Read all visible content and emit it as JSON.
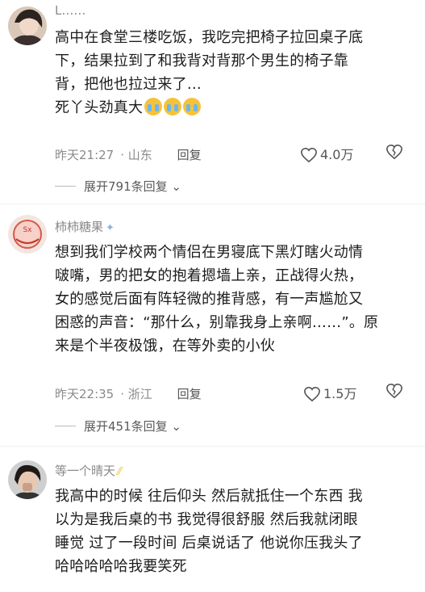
{
  "comments": [
    {
      "username": "L……",
      "lines": [
        "高中在食堂三楼吃饭，我吃完把椅子拉回桌子底",
        "下，结果拉到了和我背对背那个男生的椅子靠",
        "背，把他也拉过来了…",
        "死丫头劲真大"
      ],
      "emoji_icon": "crying-face-emoji",
      "emoji_count": 3,
      "time": "昨天21:27",
      "location": "山东",
      "reply_label": "回复",
      "likes": "4.0万",
      "expand": "展开791条回复"
    },
    {
      "username": "柿柿糖果",
      "lines": [
        "想到我们学校两个情侣在男寝底下黑灯瞎火动情",
        "啵嘴，男的把女的抱着摁墙上亲，正战得火热，",
        "女的感觉后面有阵轻微的推背感，有一声尴尬又",
        "困惑的声音：“那什么，别靠我身上亲啊……”。原",
        "来是个半夜极饿，在等外卖的小伙"
      ],
      "time": "昨天22:35",
      "location": "浙江",
      "reply_label": "回复",
      "likes": "1.5万",
      "expand": "展开451条回复"
    },
    {
      "username": "等一个晴天",
      "lines": [
        "我高中的时候 往后仰头 然后就抵住一个东西 我",
        "以为是我后桌的书 我觉得很舒服 然后我就闭眼",
        "睡觉 过了一段时间 后桌说话了 他说你压我头了",
        "哈哈哈哈哈我要笑死"
      ]
    }
  ],
  "colors": {
    "meta": "#8a8a8a",
    "text": "#1c1c1c",
    "emoji": "#f5c23a"
  }
}
